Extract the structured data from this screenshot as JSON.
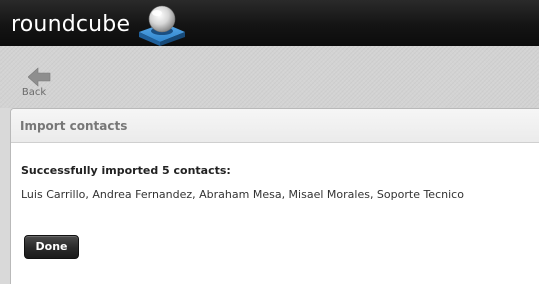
{
  "header": {
    "logo_text": "roundcube",
    "logo_icon": "roundcube-logo-icon"
  },
  "toolbar": {
    "back_label": "Back",
    "back_icon": "back-arrow-icon"
  },
  "dialog": {
    "title": "Import contacts",
    "success_message": "Successfully imported 5 contacts:",
    "imported_contacts": "Luis Carrillo, Andrea Fernandez, Abraham Mesa, Misael Morales, Soporte Tecnico",
    "done_label": "Done"
  },
  "colors": {
    "header_bg": "#141414",
    "toolbar_bg": "#d3d3d3",
    "logo_blue": "#1f6fb5",
    "button_bg": "#2b2b2b"
  }
}
